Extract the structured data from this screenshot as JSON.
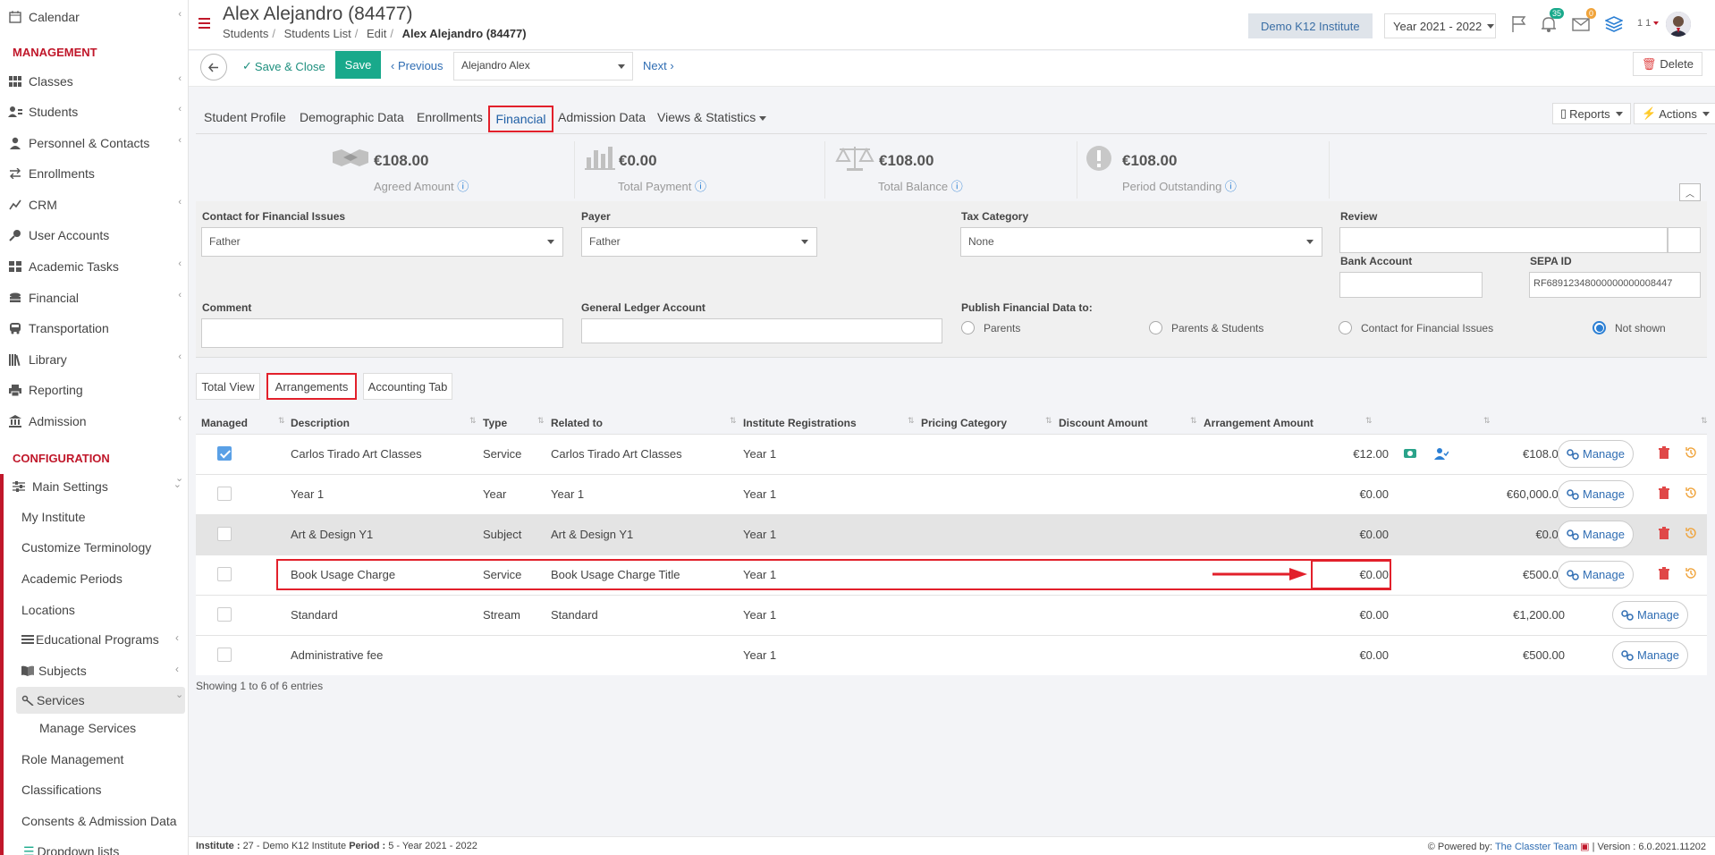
{
  "sidebar": {
    "top_items": [
      {
        "label": "Calendar",
        "icon": "calendar-icon"
      }
    ],
    "management_title": "MANAGEMENT",
    "management": [
      {
        "label": "Classes",
        "icon": "classes-icon"
      },
      {
        "label": "Students",
        "icon": "students-icon"
      },
      {
        "label": "Personnel & Contacts",
        "icon": "personnel-icon"
      },
      {
        "label": "Enrollments",
        "icon": "enrollments-icon"
      },
      {
        "label": "CRM",
        "icon": "crm-icon"
      },
      {
        "label": "User Accounts",
        "icon": "key-icon"
      },
      {
        "label": "Academic Tasks",
        "icon": "tasks-icon"
      },
      {
        "label": "Financial",
        "icon": "coins-icon"
      },
      {
        "label": "Transportation",
        "icon": "bus-icon"
      },
      {
        "label": "Library",
        "icon": "library-icon"
      },
      {
        "label": "Reporting",
        "icon": "printer-icon"
      },
      {
        "label": "Admission",
        "icon": "institution-icon"
      }
    ],
    "configuration_title": "CONFIGURATION",
    "main_settings": "Main Settings",
    "sub_items": [
      "My Institute",
      "Customize Terminology",
      "Academic Periods",
      "Locations",
      "Educational Programs",
      "Subjects",
      "Services",
      "Manage Services",
      "Role Management",
      "Classifications",
      "Consents & Admission Data",
      "Dropdown lists"
    ]
  },
  "header": {
    "title": "Alex Alejandro (84477)",
    "breadcrumb": [
      "Students",
      "Students List",
      "Edit",
      "Alex Alejandro (84477)"
    ],
    "institute": "Demo K12 Institute",
    "year": "Year 2021 - 2022",
    "notifications_count": "35",
    "messages_count": "0",
    "user_label": "1 1"
  },
  "toolbar": {
    "save_close": "Save & Close",
    "save": "Save",
    "previous": "Previous",
    "student_select": "Alejandro Alex",
    "next": "Next",
    "delete": "Delete"
  },
  "tabs": [
    "Student Profile",
    "Demographic Data",
    "Enrollments",
    "Financial",
    "Admission Data",
    "Views & Statistics"
  ],
  "tab_actions": {
    "reports": "Reports",
    "actions": "Actions"
  },
  "stats": [
    {
      "amount": "€108.00",
      "label": "Agreed Amount"
    },
    {
      "amount": "€0.00",
      "label": "Total Payment"
    },
    {
      "amount": "€108.00",
      "label": "Total Balance"
    },
    {
      "amount": "€108.00",
      "label": "Period Outstanding"
    }
  ],
  "form": {
    "contact_label": "Contact for Financial Issues",
    "contact_value": "Father",
    "payer_label": "Payer",
    "payer_value": "Father",
    "tax_label": "Tax Category",
    "tax_value": "None",
    "review_label": "Review",
    "bank_label": "Bank Account",
    "sepa_label": "SEPA ID",
    "sepa_value": "RF68912348000000000008447",
    "comment_label": "Comment",
    "gl_label": "General Ledger Account",
    "publish_label": "Publish Financial Data to:",
    "publish_options": [
      "Parents",
      "Parents & Students",
      "Contact for Financial Issues",
      "Not shown"
    ],
    "publish_selected": "Not shown"
  },
  "subtabs": [
    "Total View",
    "Arrangements",
    "Accounting Tab"
  ],
  "table": {
    "columns": [
      "Managed",
      "Description",
      "Type",
      "Related to",
      "Institute Registrations",
      "Pricing Category",
      "Discount Amount",
      "Arrangement Amount"
    ],
    "rows": [
      {
        "managed": true,
        "description": "Carlos Tirado Art Classes",
        "type": "Service",
        "related": "Carlos Tirado Art Classes",
        "registration": "Year 1",
        "pricing": "",
        "discount": "€12.00",
        "amount": "€108.00",
        "manage": "Manage"
      },
      {
        "managed": false,
        "description": "Year 1",
        "type": "Year",
        "related": "Year 1",
        "registration": "Year 1",
        "pricing": "",
        "discount": "€0.00",
        "amount": "€60,000.00",
        "manage": "Manage"
      },
      {
        "managed": false,
        "description": "Art & Design Y1",
        "type": "Subject",
        "related": "Art & Design Y1",
        "registration": "Year 1",
        "pricing": "",
        "discount": "€0.00",
        "amount": "€0.00",
        "manage": "Manage"
      },
      {
        "managed": false,
        "description": "Book Usage Charge",
        "type": "Service",
        "related": "Book Usage Charge Title",
        "registration": "Year 1",
        "pricing": "",
        "discount": "€0.00",
        "amount": "€500.00",
        "manage": "Manage"
      },
      {
        "managed": false,
        "description": "Standard",
        "type": "Stream",
        "related": "Standard",
        "registration": "Year 1",
        "pricing": "",
        "discount": "€0.00",
        "amount": "€1,200.00",
        "manage": "Manage"
      },
      {
        "managed": false,
        "description": "Administrative fee",
        "type": "",
        "related": "",
        "registration": "Year 1",
        "pricing": "",
        "discount": "€0.00",
        "amount": "€500.00",
        "manage": "Manage"
      }
    ],
    "entries_text": "Showing 1 to 6 of 6 entries"
  },
  "footer": {
    "institute_label": "Institute :",
    "institute_value": "27 - Demo K12 Institute",
    "period_label": "Period :",
    "period_value": "5 - Year 2021 - 2022",
    "powered_by": "Powered by:",
    "team": "The Classter Team",
    "version": "| Version : 6.0.2021.11202"
  },
  "colors": {
    "accent": "#c0172a",
    "save": "#19a98b",
    "link": "#2f6db3",
    "highlight": "#e2202b"
  }
}
